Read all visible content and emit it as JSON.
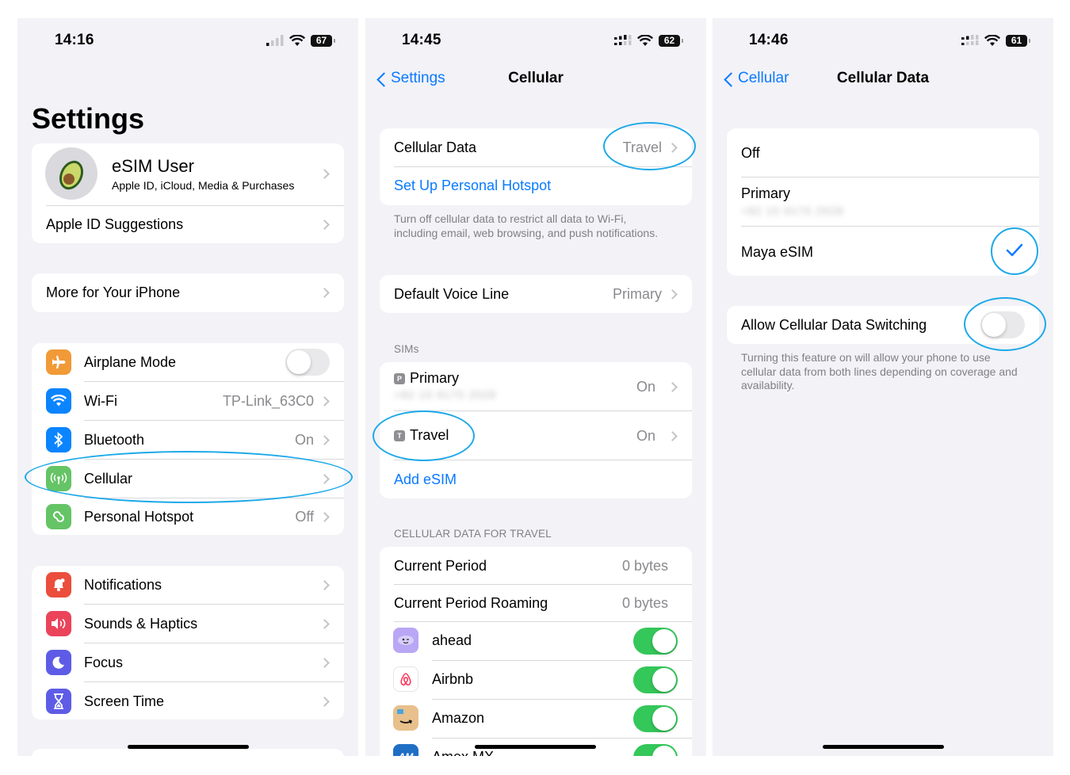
{
  "screen1": {
    "time": "14:16",
    "battery": "67",
    "title": "Settings",
    "account": {
      "name": "eSIM User",
      "subtitle": "Apple ID, iCloud, Media & Purchases"
    },
    "apple_id_suggestions": "Apple ID Suggestions",
    "more_for_iphone": "More for Your iPhone",
    "connectivity": [
      {
        "label": "Airplane Mode",
        "value": "",
        "icon": "airplane-icon",
        "color": "#f19a37",
        "toggle": false
      },
      {
        "label": "Wi-Fi",
        "value": "TP-Link_63C0",
        "icon": "wifi-icon",
        "color": "#0a84ff"
      },
      {
        "label": "Bluetooth",
        "value": "On",
        "icon": "bluetooth-icon",
        "color": "#0a84ff"
      },
      {
        "label": "Cellular",
        "value": "",
        "icon": "antenna-icon",
        "color": "#65c466"
      },
      {
        "label": "Personal Hotspot",
        "value": "Off",
        "icon": "hotspot-icon",
        "color": "#65c466"
      }
    ],
    "general": [
      {
        "label": "Notifications",
        "icon": "bell-icon",
        "color": "#eb4e3d"
      },
      {
        "label": "Sounds & Haptics",
        "icon": "speaker-icon",
        "color": "#eb445a"
      },
      {
        "label": "Focus",
        "icon": "moon-icon",
        "color": "#5e5ce6"
      },
      {
        "label": "Screen Time",
        "icon": "hourglass-icon",
        "color": "#5e5ce6"
      }
    ]
  },
  "screen2": {
    "time": "14:45",
    "battery": "62",
    "back_label": "Settings",
    "title": "Cellular",
    "cellular_data": {
      "label": "Cellular Data",
      "value": "Travel"
    },
    "hotspot_link": "Set Up Personal Hotspot",
    "footer": "Turn off cellular data to restrict all data to Wi-Fi, including email, web browsing, and push notifications.",
    "voice_line": {
      "label": "Default Voice Line",
      "value": "Primary"
    },
    "sims_header": "SIMs",
    "sims": [
      {
        "badge": "P",
        "label": "Primary",
        "value": "On",
        "number": "+82 10 9175 2028"
      },
      {
        "badge": "T",
        "label": "Travel",
        "value": "On"
      }
    ],
    "add_esim": "Add eSIM",
    "usage_header": "CELLULAR DATA FOR TRAVEL",
    "usage": [
      {
        "label": "Current Period",
        "value": "0 bytes"
      },
      {
        "label": "Current Period Roaming",
        "value": "0 bytes"
      }
    ],
    "apps": [
      {
        "label": "ahead",
        "icon": "ahead-app-icon",
        "color": "#b9a6f4",
        "toggle": true
      },
      {
        "label": "Airbnb",
        "icon": "airbnb-app-icon",
        "color": "#ffffff",
        "toggle": true
      },
      {
        "label": "Amazon",
        "icon": "amazon-app-icon",
        "color": "#e8c08b",
        "toggle": true
      },
      {
        "label": "Amex MX",
        "icon": "amex-app-icon",
        "color": "#1f6fc5",
        "toggle": true
      }
    ]
  },
  "screen3": {
    "time": "14:46",
    "battery": "61",
    "back_label": "Cellular",
    "title": "Cellular Data",
    "options": [
      {
        "label": "Off"
      },
      {
        "label": "Primary",
        "number": "+82 10 9175 2028"
      },
      {
        "label": "Maya eSIM",
        "selected": true
      }
    ],
    "switching_label": "Allow Cellular Data Switching",
    "switching_on": false,
    "switching_footer": "Turning this feature on will allow your phone to use cellular data from both lines depending on coverage and availability."
  },
  "colors": {
    "accent": "#0a7aff",
    "toggle_on": "#34c759",
    "highlight_ring": "#1da9e8"
  }
}
